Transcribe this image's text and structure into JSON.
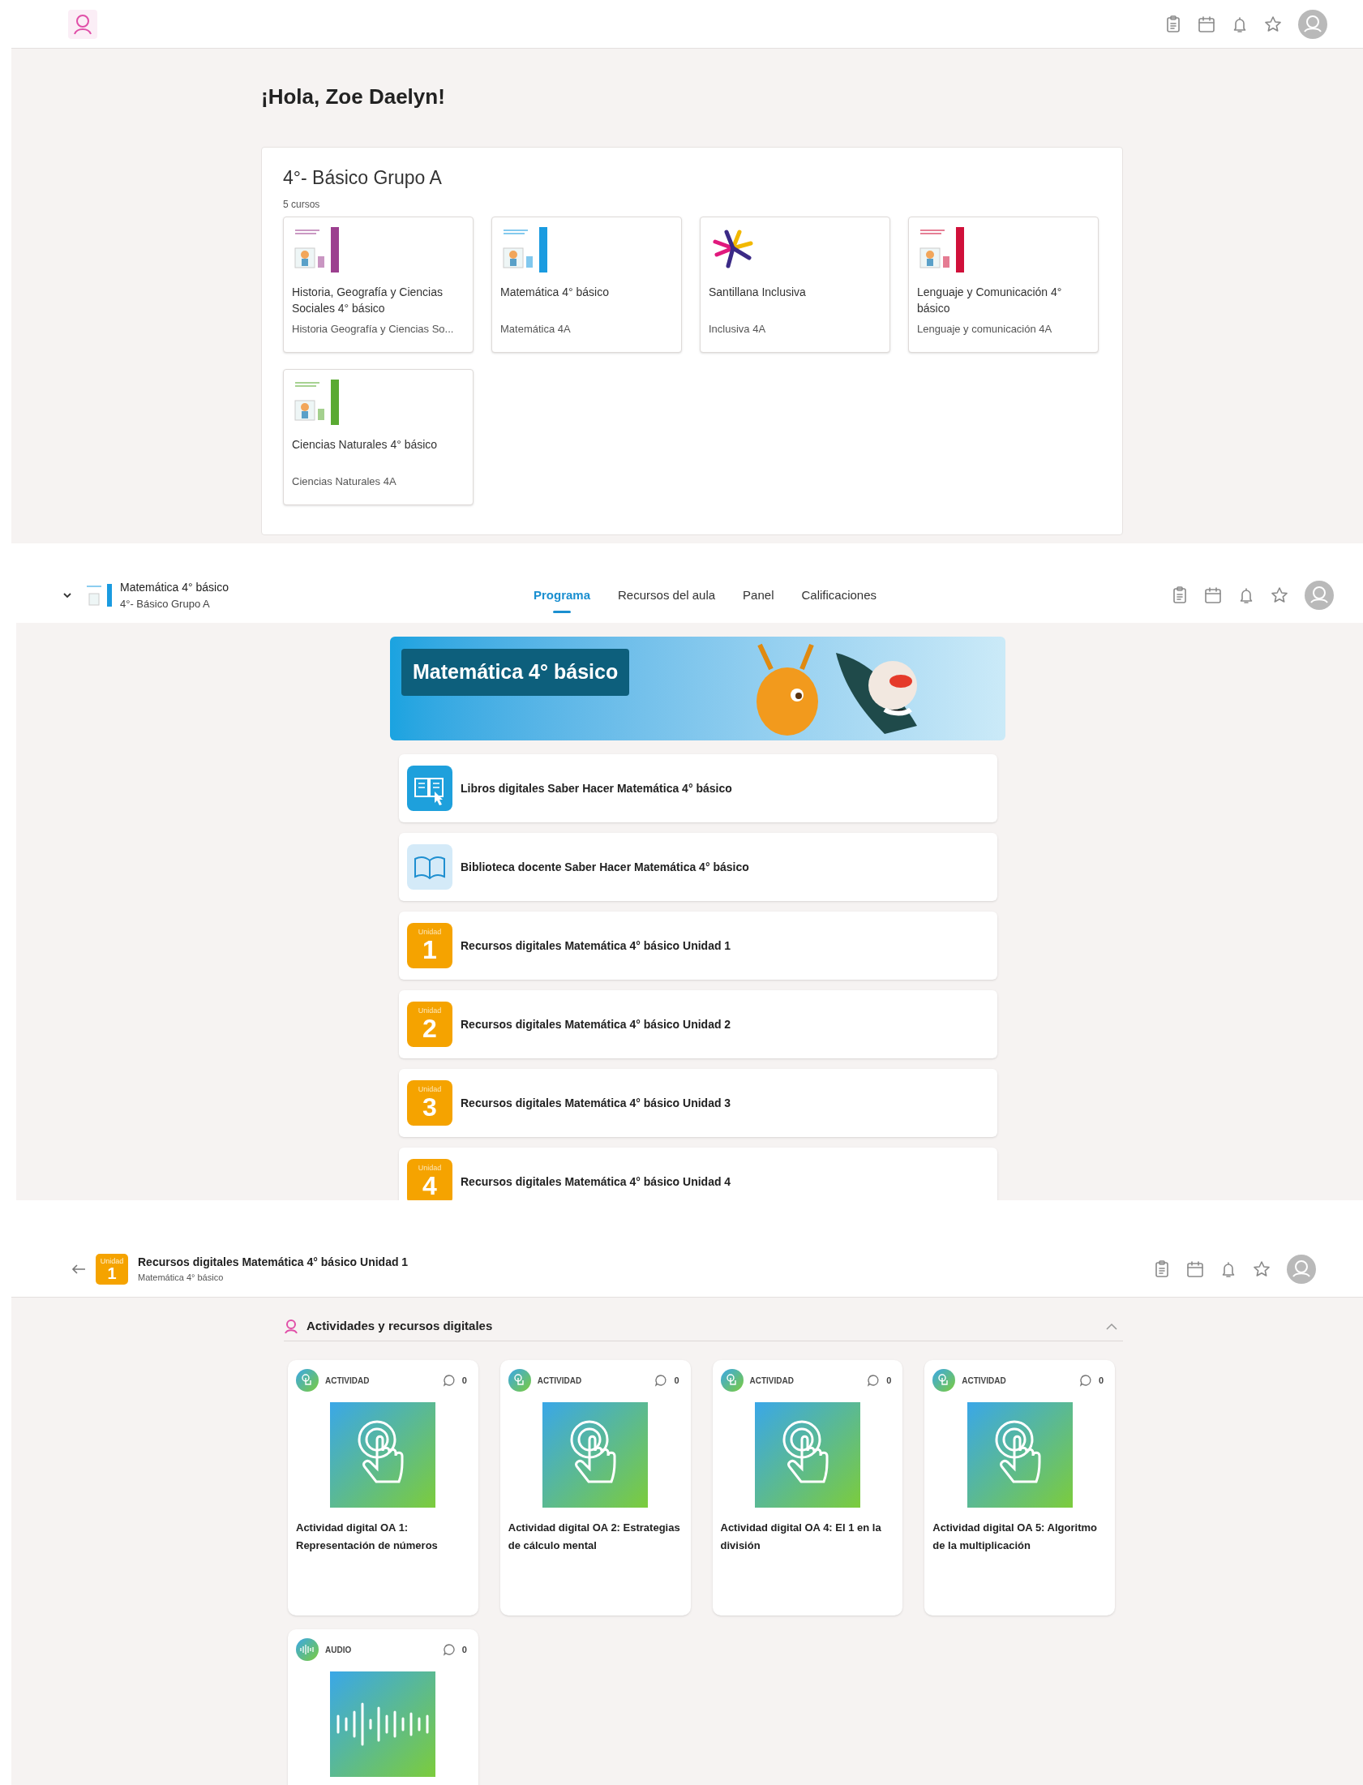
{
  "home": {
    "greeting": "¡Hola, Zoe Daelyn!",
    "group": {
      "title": "4°- Básico Grupo A",
      "count": "5 cursos",
      "courses": [
        {
          "kind": "book",
          "color": "#9c3f8f",
          "title": "Historia, Geografía y Ciencias Sociales 4° básico",
          "subtitle": "Historia Geografía y Ciencias So..."
        },
        {
          "kind": "book",
          "color": "#1a9be0",
          "title": "Matemática 4° básico",
          "subtitle": "Matemática 4A"
        },
        {
          "kind": "logo",
          "color": "#3b2a86",
          "title": "Santillana Inclusiva",
          "subtitle": "Inclusiva 4A"
        },
        {
          "kind": "book",
          "color": "#d0103a",
          "title": "Lenguaje y Comunicación 4° básico",
          "subtitle": "Lenguaje y comunicación 4A"
        },
        {
          "kind": "book",
          "color": "#5aaa32",
          "title": "Ciencias Naturales 4° básico",
          "subtitle": "Ciencias Naturales 4A"
        }
      ]
    }
  },
  "course": {
    "title": "Matemática 4° básico",
    "group": "4°- Básico Grupo A",
    "tabs": [
      {
        "label": "Programa",
        "selected": true
      },
      {
        "label": "Recursos del aula",
        "selected": false
      },
      {
        "label": "Panel",
        "selected": false
      },
      {
        "label": "Calificaciones",
        "selected": false
      }
    ],
    "banner_title": "Matemática 4° básico",
    "items": [
      {
        "kind": "digital_book",
        "label": "Libros digitales Saber Hacer Matemática 4° básico"
      },
      {
        "kind": "library",
        "label": "Biblioteca docente Saber Hacer Matemática 4° básico"
      },
      {
        "kind": "unit",
        "badge": "Unidad",
        "number": "1",
        "label": "Recursos digitales Matemática 4° básico Unidad 1"
      },
      {
        "kind": "unit",
        "badge": "Unidad",
        "number": "2",
        "label": "Recursos digitales Matemática 4° básico Unidad 2"
      },
      {
        "kind": "unit",
        "badge": "Unidad",
        "number": "3",
        "label": "Recursos digitales Matemática 4° básico Unidad 3"
      },
      {
        "kind": "unit",
        "badge": "Unidad",
        "number": "4",
        "label": "Recursos digitales Matemática 4° básico Unidad 4"
      }
    ]
  },
  "unit": {
    "badge": "Unidad",
    "number": "1",
    "title": "Recursos digitales Matemática 4° básico Unidad 1",
    "subtitle": "Matemática 4° básico",
    "section": {
      "title": "Actividades y recursos digitales",
      "expanded": true,
      "cards": [
        {
          "kind": "activity",
          "type": "ACTIVIDAD",
          "comments": "0",
          "title": "Actividad digital OA 1: Representación de números"
        },
        {
          "kind": "activity",
          "type": "ACTIVIDAD",
          "comments": "0",
          "title": "Actividad digital OA 2: Estrategias de cálculo mental"
        },
        {
          "kind": "activity",
          "type": "ACTIVIDAD",
          "comments": "0",
          "title": "Actividad digital OA 4: El 1 en la división"
        },
        {
          "kind": "activity",
          "type": "ACTIVIDAD",
          "comments": "0",
          "title": "Actividad digital OA 5: Algoritmo de la multiplicación"
        },
        {
          "kind": "audio",
          "type": "AUDIO",
          "comments": "0"
        }
      ]
    }
  }
}
